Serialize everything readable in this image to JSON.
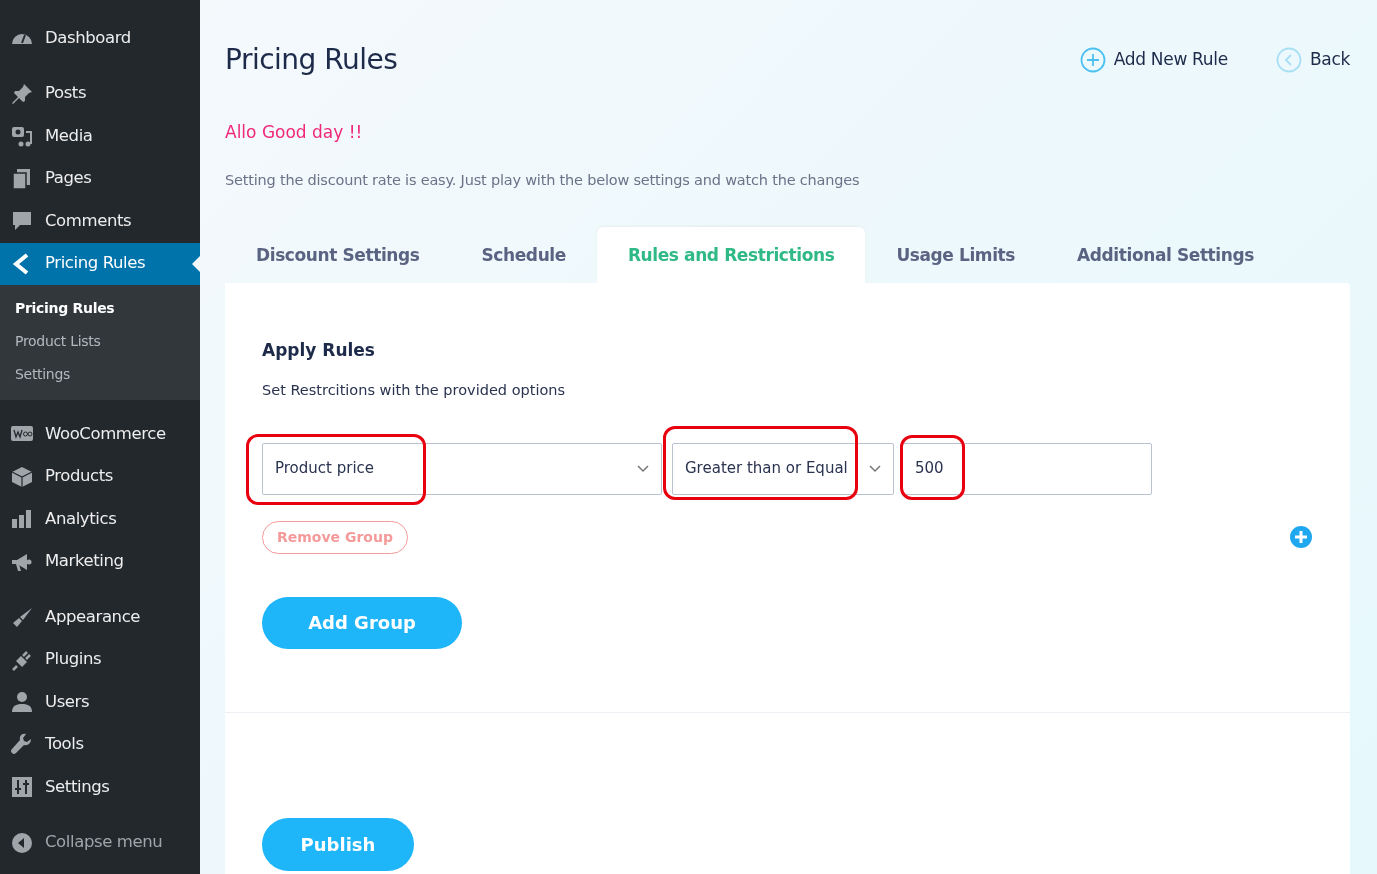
{
  "sidebar": {
    "groups": [
      {
        "items": [
          {
            "label": "Dashboard",
            "selected": false
          }
        ]
      },
      {
        "items": [
          {
            "label": "Posts",
            "selected": false
          },
          {
            "label": "Media",
            "selected": false
          },
          {
            "label": "Pages",
            "selected": false
          },
          {
            "label": "Comments",
            "selected": false
          },
          {
            "label": "Pricing Rules",
            "selected": true,
            "children": [
              {
                "label": "Pricing Rules",
                "selected": true
              },
              {
                "label": "Product Lists",
                "selected": false
              },
              {
                "label": "Settings",
                "selected": false
              }
            ]
          }
        ]
      },
      {
        "items": [
          {
            "label": "WooCommerce",
            "selected": false
          },
          {
            "label": "Products",
            "selected": false
          },
          {
            "label": "Analytics",
            "selected": false
          },
          {
            "label": "Marketing",
            "selected": false
          }
        ]
      },
      {
        "items": [
          {
            "label": "Appearance",
            "selected": false
          },
          {
            "label": "Plugins",
            "selected": false
          },
          {
            "label": "Users",
            "selected": false
          },
          {
            "label": "Tools",
            "selected": false
          },
          {
            "label": "Settings",
            "selected": false
          }
        ]
      }
    ],
    "collapse": "Collapse menu"
  },
  "header": {
    "title": "Pricing Rules",
    "actions": [
      {
        "label": "Add New Rule",
        "kind": "add"
      },
      {
        "label": "Back",
        "kind": "back"
      }
    ]
  },
  "greeting": "Allo Good day !!",
  "description": "Setting the discount rate is easy. Just play with the below settings and watch the changes",
  "tabs": [
    {
      "label": "Discount Settings",
      "selected": false
    },
    {
      "label": "Schedule",
      "selected": false
    },
    {
      "label": "Rules and Restrictions",
      "selected": true
    },
    {
      "label": "Usage Limits",
      "selected": false
    },
    {
      "label": "Additional Settings",
      "selected": false
    }
  ],
  "panel": {
    "heading": "Apply Rules",
    "subheading": "Set Restrcitions with the provided options",
    "fields": [
      {
        "kind": "select",
        "value": "Product price",
        "highlighted": true
      },
      {
        "kind": "select",
        "value": "Greater than or Equal",
        "highlighted": true
      },
      {
        "kind": "input",
        "value": "500",
        "highlighted": true
      }
    ],
    "remove_button": "Remove Group",
    "add_button": "Add Group",
    "publish_button": "Publish"
  }
}
